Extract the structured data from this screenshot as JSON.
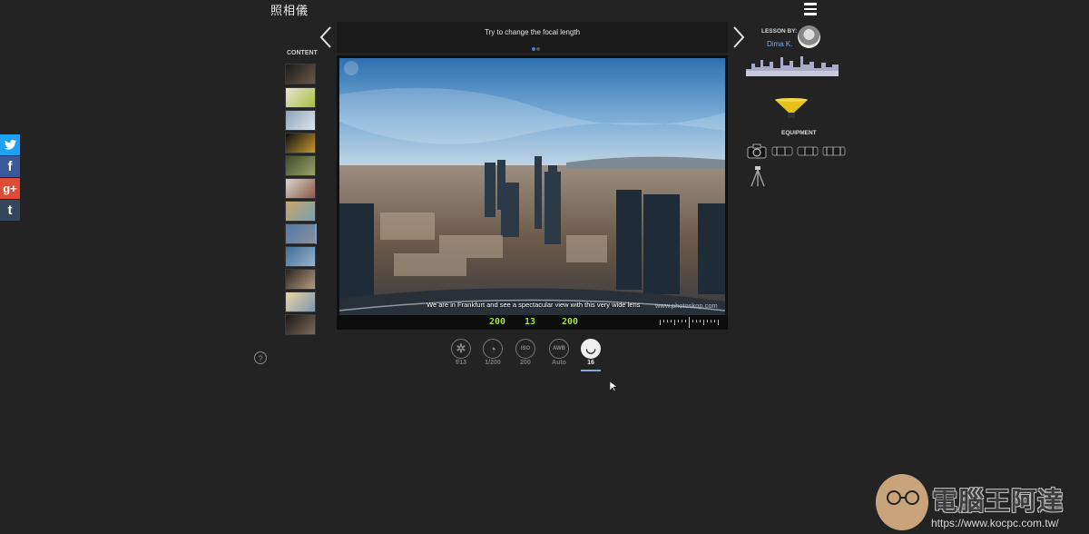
{
  "app": {
    "title": "照相儀"
  },
  "share": [
    {
      "network": "twitter",
      "glyph": "🐦",
      "color": "#1da1f2"
    },
    {
      "network": "facebook",
      "glyph": "f",
      "color": "#3b5998"
    },
    {
      "network": "google-plus",
      "glyph": "g+",
      "color": "#dd4b39"
    },
    {
      "network": "tumblr",
      "glyph": "t",
      "color": "#35465c"
    }
  ],
  "content": {
    "label": "CONTENT",
    "thumbnails": [
      {
        "colors": [
          "#1a1a1a",
          "#6b5a4a"
        ]
      },
      {
        "colors": [
          "#e9e4d6",
          "#a7c03a"
        ]
      },
      {
        "colors": [
          "#8fa3b5",
          "#dfe6ee"
        ]
      },
      {
        "colors": [
          "#0f0f0f",
          "#c79a2e"
        ]
      },
      {
        "colors": [
          "#3f4a2a",
          "#9aa36a"
        ]
      },
      {
        "colors": [
          "#d9d4cf",
          "#8a5a4a"
        ]
      },
      {
        "colors": [
          "#c7a76a",
          "#7aa0b0"
        ]
      },
      {
        "colors": [
          "#4f7ab0",
          "#8a8f96"
        ]
      },
      {
        "colors": [
          "#3e6e9a",
          "#9ab3c8"
        ]
      },
      {
        "colors": [
          "#2a2522",
          "#b59c82"
        ]
      },
      {
        "colors": [
          "#e8d6a8",
          "#7f96ad"
        ]
      },
      {
        "colors": [
          "#1c1917",
          "#7a6a5c"
        ]
      }
    ],
    "active_index": 7
  },
  "stage": {
    "instruction": "Try to change the focal length",
    "caption": "We are in Frankfurt and see a spectacular view with this very wide lens",
    "watermark": "www.photoskop.com",
    "readout": {
      "shutter": "200",
      "aperture": "13",
      "iso": "200"
    }
  },
  "controls": [
    {
      "name": "aperture-icon",
      "symbol": "✲",
      "label": "f/13"
    },
    {
      "name": "shutter-icon",
      "symbol": "◔",
      "label": "1/200"
    },
    {
      "name": "iso-icon",
      "symbol": "ISO",
      "label": "200"
    },
    {
      "name": "white-balance-icon",
      "symbol": "AWB",
      "label": "Auto"
    },
    {
      "name": "focal-length-icon",
      "symbol": "◡",
      "label": "16"
    }
  ],
  "controls_active_index": 4,
  "help": {
    "symbol": "?"
  },
  "lesson": {
    "label": "LESSON BY:",
    "author": "Dima K."
  },
  "equipment": {
    "label": "EQUIPMENT"
  },
  "site_logo": {
    "text": "電腦王阿達",
    "url": "https://www.kocpc.com.tw/"
  }
}
